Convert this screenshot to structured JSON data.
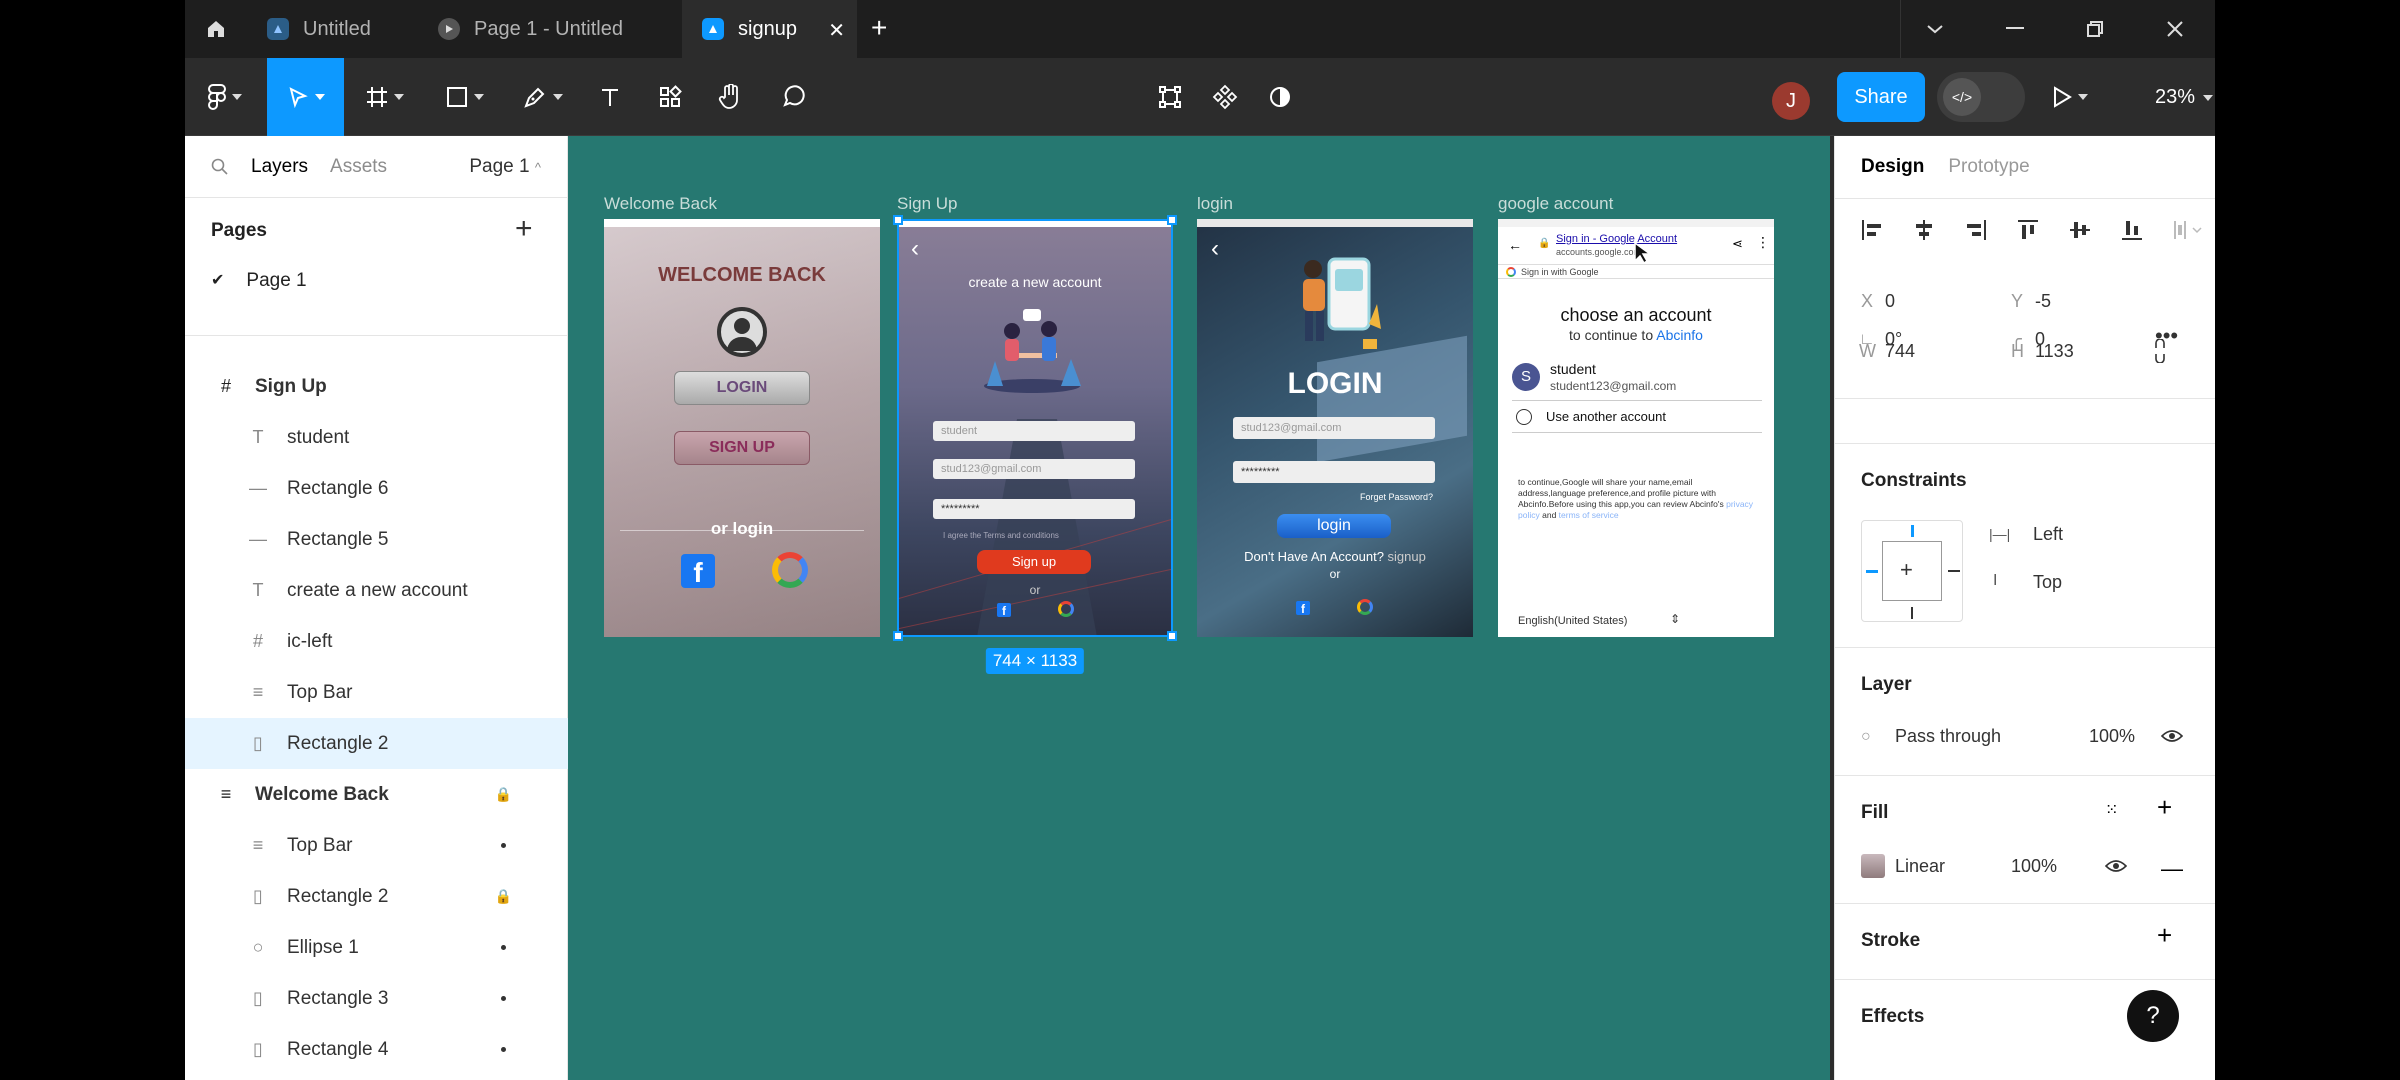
{
  "tabs": [
    {
      "label": "Untitled"
    },
    {
      "label": "Page 1 - Untitled"
    },
    {
      "label": "signup"
    }
  ],
  "toolbar": {
    "share": "Share",
    "zoom": "23%",
    "avatar_initial": "J"
  },
  "left_panel": {
    "tab_layers": "Layers",
    "tab_assets": "Assets",
    "page_selector": "Page 1",
    "pages_title": "Pages",
    "pages": [
      {
        "name": "Page 1"
      }
    ],
    "layers": [
      {
        "name": "Sign Up",
        "icon": "frame-icon",
        "level": 0
      },
      {
        "name": "student",
        "icon": "text-icon",
        "level": 1
      },
      {
        "name": "Rectangle 6",
        "icon": "line-icon",
        "level": 1
      },
      {
        "name": "Rectangle 5",
        "icon": "line-icon",
        "level": 1
      },
      {
        "name": "create a new account",
        "icon": "text-icon",
        "level": 1
      },
      {
        "name": "ic-left",
        "icon": "frame-icon",
        "level": 1
      },
      {
        "name": "Top Bar",
        "icon": "autolayout-icon",
        "level": 1
      },
      {
        "name": "Rectangle 2",
        "icon": "rectangle-icon",
        "level": 1,
        "selected": true
      },
      {
        "name": "Welcome Back",
        "icon": "autolayout-icon",
        "level": 0,
        "locked": true
      },
      {
        "name": "Top Bar",
        "icon": "autolayout-icon",
        "level": 1
      },
      {
        "name": "Rectangle 2",
        "icon": "rectangle-icon",
        "level": 1,
        "locked": true
      },
      {
        "name": "Ellipse 1",
        "icon": "ellipse-icon",
        "level": 1
      },
      {
        "name": "Rectangle 3",
        "icon": "rectangle-icon",
        "level": 1
      },
      {
        "name": "Rectangle 4",
        "icon": "rectangle-icon",
        "level": 1
      }
    ]
  },
  "canvas": {
    "frames": [
      {
        "label": "Welcome Back",
        "title": "WELCOME BACK",
        "login": "LOGIN",
        "signup": "SIGN UP",
        "or_login": "or login"
      },
      {
        "label": "Sign Up",
        "title": "create a new account",
        "field_name": "student",
        "field_email": "stud123@gmail.com",
        "field_password": "*********",
        "terms": "I agree the Terms and conditions",
        "button": "Sign up",
        "or": "or"
      },
      {
        "label": "login",
        "title": "LOGIN",
        "field_email": "stud123@gmail.com",
        "field_password": "*********",
        "forget": "Forget Password?",
        "button": "login",
        "no_account": "Don't Have An Account?",
        "signup_link": "signup",
        "or": "or"
      },
      {
        "label": "google account",
        "url_title": "Sign in - Google Account",
        "url": "accounts.google.com",
        "sign_in_with": "Sign in with Google",
        "heading": "choose an account",
        "sub": "to continue to",
        "app": "Abcinfo",
        "account_initial": "S",
        "account_name": "student",
        "account_email": "student123@gmail.com",
        "use_another": "Use another account",
        "disclaimer": "to continue,Google will share your name,email address,language preference,and profile picture with Abcinfo.Before using this app,you can review Abcinfo's",
        "privacy": "privacy policy",
        "and": "and",
        "terms": "terms of service",
        "language": "English(United States)"
      }
    ],
    "size_badge": "744 × 1133"
  },
  "right_panel": {
    "tab_design": "Design",
    "tab_prototype": "Prototype",
    "x_label": "X",
    "x": "0",
    "y_label": "Y",
    "y": "-5",
    "w_label": "W",
    "w": "744",
    "h_label": "H",
    "h": "1133",
    "rotation": "0°",
    "radius": "0",
    "constraints_title": "Constraints",
    "constraint_h": "Left",
    "constraint_v": "Top",
    "layer_title": "Layer",
    "blend": "Pass through",
    "layer_opacity": "100%",
    "fill_title": "Fill",
    "fill_type": "Linear",
    "fill_opacity": "100%",
    "stroke_title": "Stroke",
    "effects_title": "Effects"
  },
  "colors": {
    "accent": "#0d99ff",
    "canvas": "#267871",
    "signup_red": "#e03a1e",
    "login_blue": "#1a73e8"
  }
}
